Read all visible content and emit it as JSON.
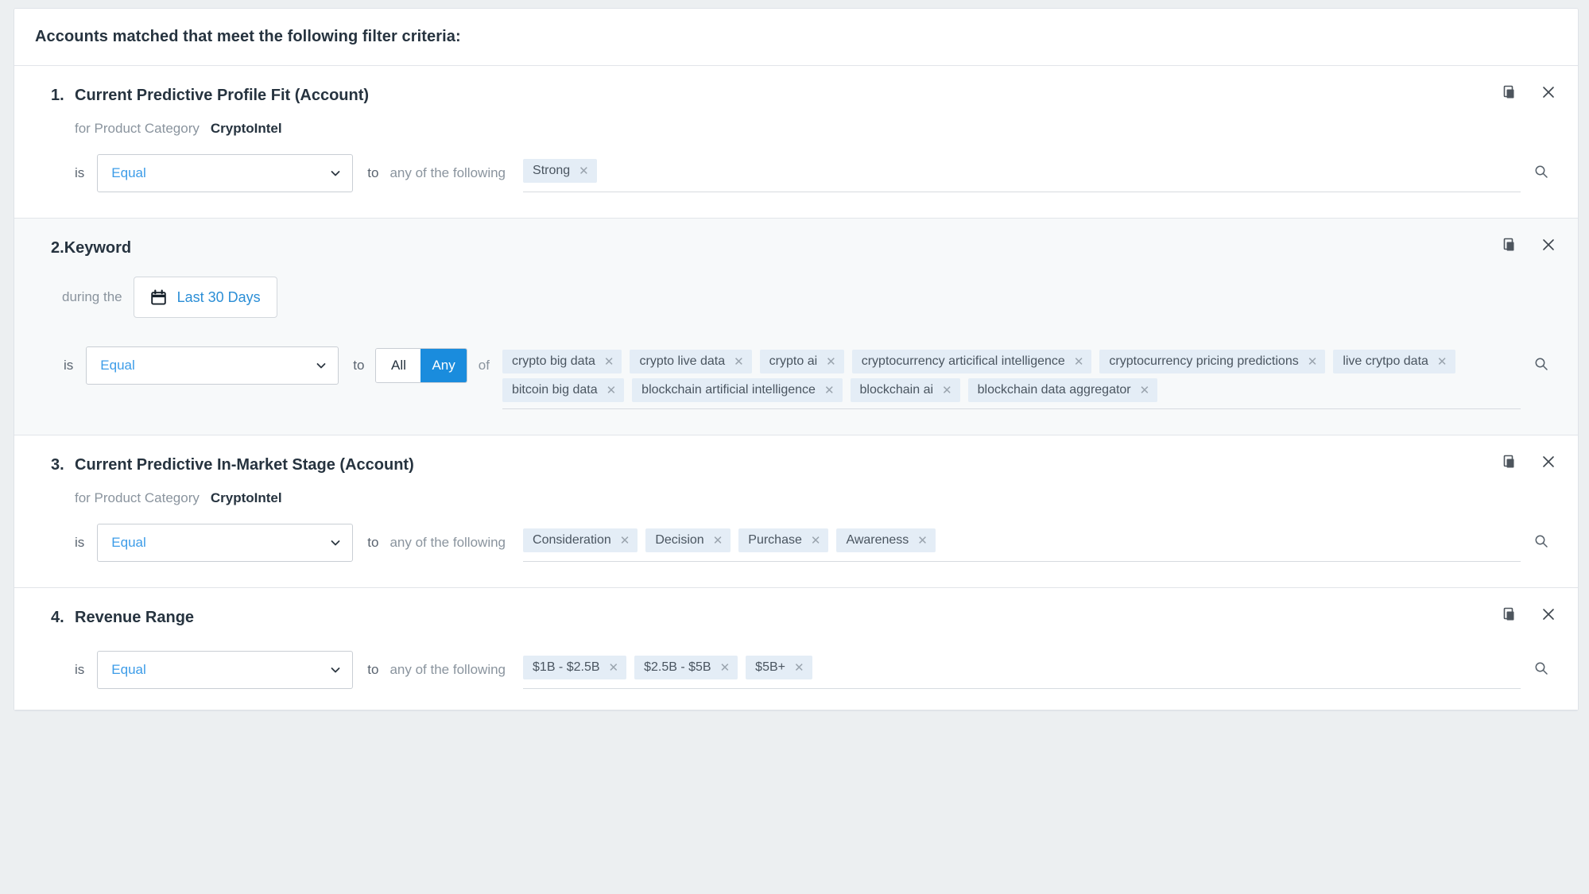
{
  "header": {
    "title": "Accounts matched that meet the following filter criteria:"
  },
  "colors": {
    "accent_blue": "#1a8cdd",
    "link_blue": "#3c9ce8",
    "token_bg": "#e4edf6",
    "alt_row_bg": "#f7f9fa",
    "title_text": "#26333f"
  },
  "labels": {
    "is": "is",
    "to": "to",
    "of": "of",
    "any_of_the_following": "any of the following",
    "for_product_category": "for Product Category",
    "during_the": "during the",
    "copy_icon": "copy-icon",
    "close_icon": "close-icon",
    "search_icon": "search-icon",
    "calendar_icon": "calendar-icon",
    "chevron_down_icon": "chevron-down-icon"
  },
  "filters": [
    {
      "number": "1.",
      "title": "Current Predictive Profile Fit (Account)",
      "product_category_label": "for Product Category",
      "product_category_value": "CryptoIntel",
      "operator": "Equal",
      "match_label": "any of the following",
      "tokens": [
        "Strong"
      ]
    },
    {
      "number": "2.",
      "title": "Keyword",
      "date_range_label": "during the",
      "date_range_value": "Last 30 Days",
      "operator": "Equal",
      "segmented": {
        "options": [
          "All",
          "Any"
        ],
        "selected": "Any"
      },
      "of_label": "of",
      "tokens": [
        "crypto big data",
        "crypto live data",
        "crypto ai",
        "cryptocurrency articifical intelligence",
        "cryptocurrency pricing predictions",
        "live crytpo data",
        "bitcoin big data",
        "blockchain artificial intelligence",
        "blockchain ai",
        "blockchain data aggregator"
      ]
    },
    {
      "number": "3.",
      "title": "Current Predictive In-Market Stage (Account)",
      "product_category_label": "for Product Category",
      "product_category_value": "CryptoIntel",
      "operator": "Equal",
      "match_label": "any of the following",
      "tokens": [
        "Consideration",
        "Decision",
        "Purchase",
        "Awareness"
      ]
    },
    {
      "number": "4.",
      "title": "Revenue Range",
      "operator": "Equal",
      "match_label": "any of the following",
      "tokens": [
        "$1B - $2.5B",
        "$2.5B - $5B",
        "$5B+"
      ]
    }
  ]
}
